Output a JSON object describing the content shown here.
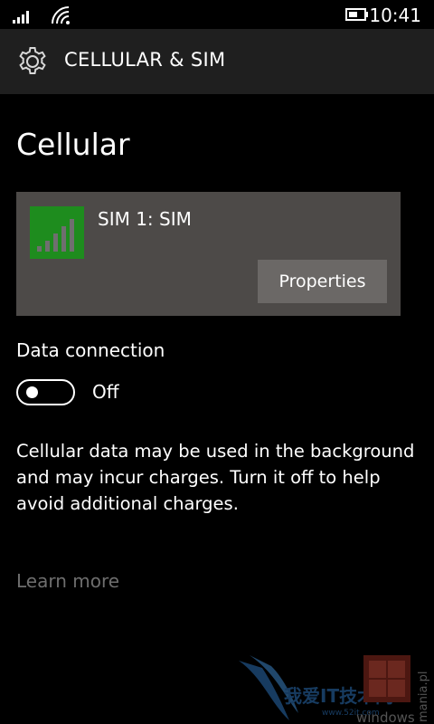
{
  "status_bar": {
    "time": "10:41",
    "icons": [
      "signal-strength-icon",
      "wifi-icon",
      "battery-icon"
    ]
  },
  "header": {
    "icon": "gear-icon",
    "title": "CELLULAR & SIM"
  },
  "page": {
    "title": "Cellular"
  },
  "sim": {
    "name": "SIM 1: SIM",
    "tile_color": "#1e8c1e",
    "properties_label": "Properties"
  },
  "data_connection": {
    "label": "Data connection",
    "state": "Off",
    "enabled": false
  },
  "description": "Cellular data may be used in the background and may incur charges. Turn it off to help avoid additional charges.",
  "learn_more": "Learn more",
  "colors": {
    "background": "#000000",
    "header": "#1f1f1f",
    "card": "#4d4a48",
    "button": "#6b6866",
    "link": "#6e6e6e"
  },
  "watermark": {
    "brand_text": "windowsmania.pl",
    "cn_text": "我爱IT技术网",
    "cn_url": "www.52it.com"
  }
}
